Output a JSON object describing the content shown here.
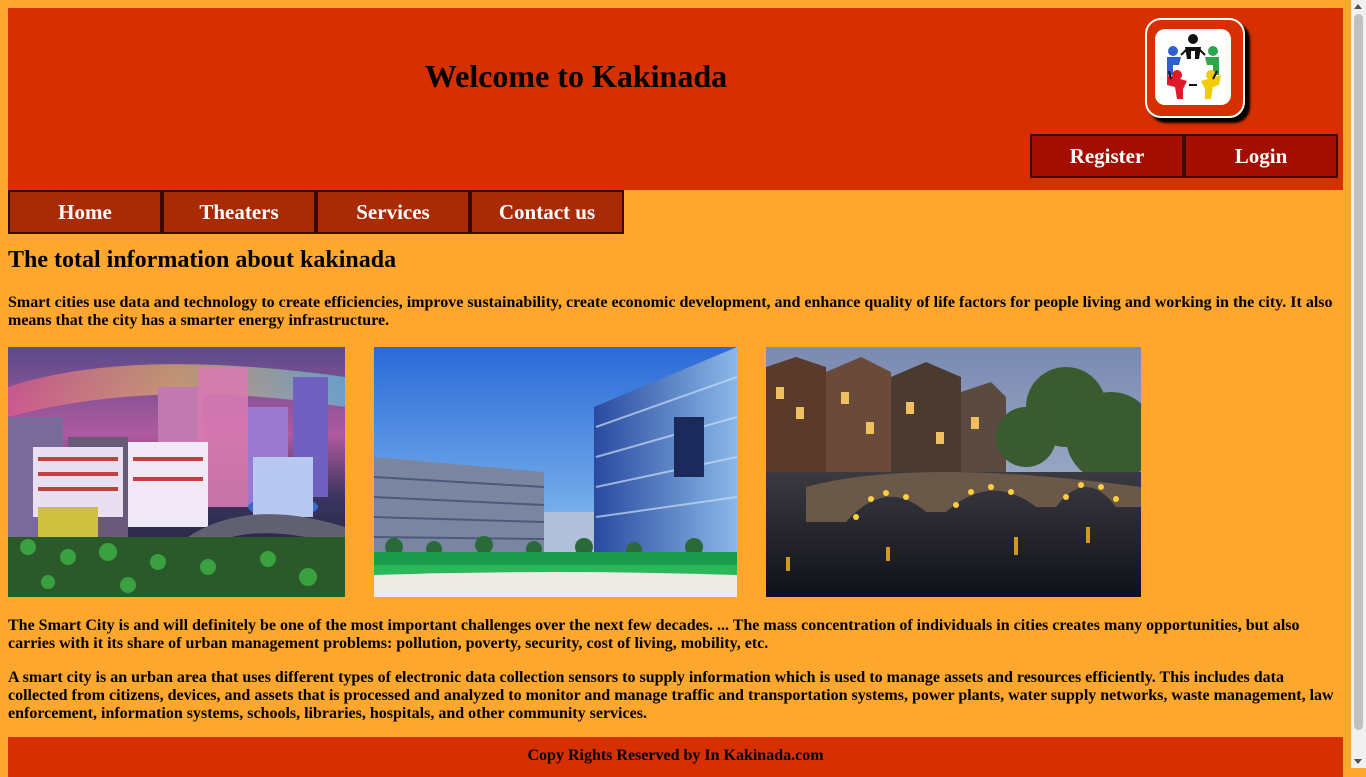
{
  "header": {
    "title": "Welcome to Kakinada",
    "logo_icon": "people-circle-logo-icon",
    "register_label": "Register",
    "login_label": "Login",
    "colors": {
      "header_bg": "#d62f00",
      "button_bg": "#a40e00",
      "page_bg": "#fea72f"
    }
  },
  "nav": {
    "items": [
      {
        "label": "Home"
      },
      {
        "label": "Theaters"
      },
      {
        "label": "Services"
      },
      {
        "label": "Contact us"
      }
    ]
  },
  "main": {
    "heading": "The total information about kakinada",
    "intro": "Smart cities use data and technology to create efficiencies, improve sustainability, create economic development, and enhance quality of life factors for people living and working in the city. It also means that the city has a smarter energy infrastructure.",
    "images": [
      {
        "icon": "smart-city-model-image"
      },
      {
        "icon": "glass-office-buildings-image"
      },
      {
        "icon": "canal-bridge-night-image"
      }
    ],
    "paragraph_2": "The Smart City is and will definitely be one of the most important challenges over the next few decades. ... The mass concentration of individuals in cities creates many opportunities, but also carries with it its share of urban management problems: pollution, poverty, security, cost of living, mobility, etc.",
    "paragraph_3": "A smart city is an urban area that uses different types of electronic data collection sensors to supply information which is used to manage assets and resources efficiently. This includes data collected from citizens, devices, and assets that is processed and analyzed to monitor and manage traffic and transportation systems, power plants, water supply networks, waste management, law enforcement, information systems, schools, libraries, hospitals, and other community services."
  },
  "footer": {
    "text": "Copy Rights Reserved by In Kakinada.com"
  }
}
